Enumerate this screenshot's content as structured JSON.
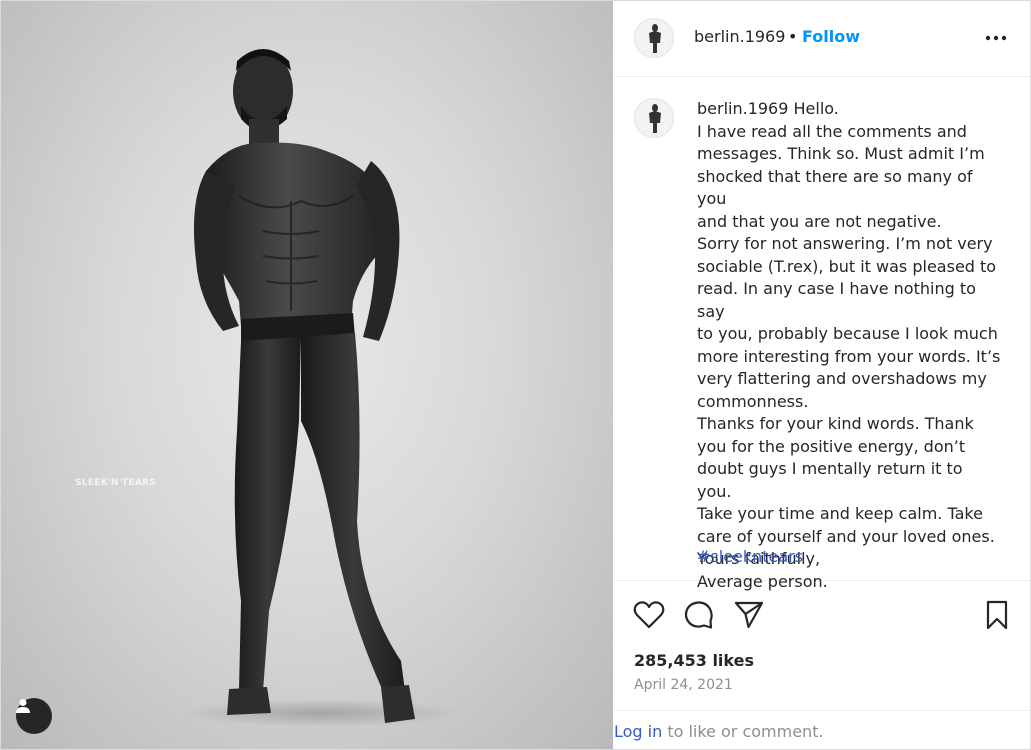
{
  "post": {
    "username": "berlin.1969",
    "separator": "•",
    "follow_label": "Follow",
    "more_icon": "more-horizontal-icon",
    "watermark": "SLEEK'N'TEARS"
  },
  "caption": {
    "username": "berlin.1969",
    "text": " Hello.\nI have read all the comments and\nmessages. Think so. Must admit I’m\nshocked that there are so many of you\nand that you are not negative.\nSorry for not answering. I’m not very\nsociable (T.rex), but it was pleased to\nread. In any case I have nothing to say\nto you, probably because I look much\nmore interesting from your words. It’s\nvery flattering and overshadows my\ncommonness.\nThanks for your kind words. Thank\nyou for the positive energy, don’t\ndoubt guys I mentally return it to you.\nTake your time and keep calm. Take\ncare of yourself and your loved ones.\nYours faithfully,\nAverage person.",
    "hashtag": "#sleekntears"
  },
  "actions": {
    "icons": [
      "heart-icon",
      "comment-icon",
      "share-icon",
      "bookmark-icon"
    ]
  },
  "stats": {
    "likes": "285,453 likes",
    "date": "April 24, 2021"
  },
  "login": {
    "link": "Log in",
    "text": " to like or comment."
  },
  "colors": {
    "follow": "#0095f6",
    "hashtag": "#3858c7",
    "text": "#262626",
    "muted": "#8e8e8e"
  }
}
